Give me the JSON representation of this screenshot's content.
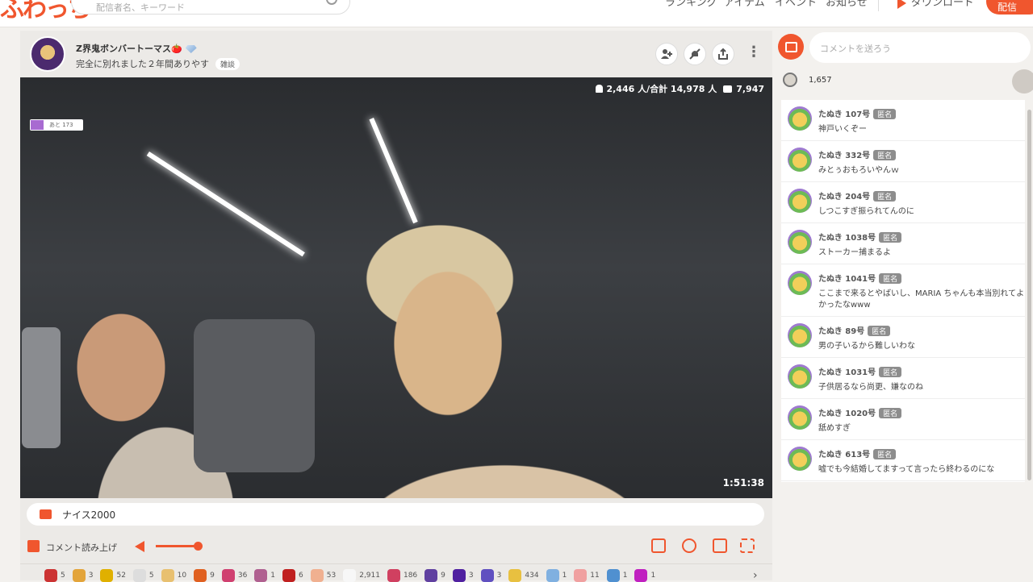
{
  "header": {
    "logo": "ふわっち",
    "search_placeholder": "配信者名、キーワード",
    "nav": [
      "ランキング",
      "アイテム",
      "イベント",
      "お知らせ"
    ],
    "download": "ダウンロード",
    "live_button": "配信"
  },
  "stream": {
    "streamer_name": "Z界鬼ボンバートーマス🍅",
    "title": "完全に別れました２年間ありやす",
    "tag": "雑談",
    "viewers": "2,446 人/合計 14,978 人",
    "comment_count": "7,947",
    "rank_badge": "あと 173",
    "duration": "1:51:38",
    "comment_overlay": "ナイス2000",
    "read_aloud": "コメント読み上げ",
    "volume_percent": 100
  },
  "gifts": [
    {
      "count": "5",
      "color": "#c33"
    },
    {
      "count": "3",
      "color": "#e3a43a"
    },
    {
      "count": "52",
      "color": "#e0b000"
    },
    {
      "count": "5",
      "color": "#ddd"
    },
    {
      "count": "10",
      "color": "#e8c070"
    },
    {
      "count": "9",
      "color": "#e06020"
    },
    {
      "count": "36",
      "color": "#d04070"
    },
    {
      "count": "1",
      "color": "#b06090"
    },
    {
      "count": "6",
      "color": "#c02020"
    },
    {
      "count": "53",
      "color": "#f0b090"
    },
    {
      "count": "2,911",
      "color": "#f7f7f7"
    },
    {
      "count": "186",
      "color": "#d04060"
    },
    {
      "count": "9",
      "color": "#6040a0"
    },
    {
      "count": "3",
      "color": "#5020a0"
    },
    {
      "count": "3",
      "color": "#6050c0"
    },
    {
      "count": "434",
      "color": "#e8c040"
    },
    {
      "count": "1",
      "color": "#80b0e0"
    },
    {
      "count": "11",
      "color": "#f0a0a0"
    },
    {
      "count": "1",
      "color": "#5090d0"
    },
    {
      "count": "1",
      "color": "#c020c0"
    }
  ],
  "chat": {
    "placeholder": "コメントを送ろう",
    "clap_count": "1,657",
    "anon_label": "匿名",
    "messages": [
      {
        "name": "たぬき 107号",
        "text": "神戸いくぞー"
      },
      {
        "name": "たぬき 332号",
        "text": "みとぅおもろいやんｗ"
      },
      {
        "name": "たぬき 204号",
        "text": "しつこすぎ振られてんのに"
      },
      {
        "name": "たぬき 1038号",
        "text": "ストーカー捕まるよ"
      },
      {
        "name": "たぬき 1041号",
        "text": "ここまで来るとやばいし、MARIA ちゃんも本当別れてよかったなwww"
      },
      {
        "name": "たぬき 89号",
        "text": "男の子いるから難しいわな"
      },
      {
        "name": "たぬき 1031号",
        "text": "子供居るなら尚更、嫌なのね"
      },
      {
        "name": "たぬき 1020号",
        "text": "舐めすぎ"
      },
      {
        "name": "たぬき 613号",
        "text": "嘘でも今結婚してますって言ったら終わるのにな"
      }
    ]
  },
  "colors": {
    "accent": "#f0562e"
  }
}
